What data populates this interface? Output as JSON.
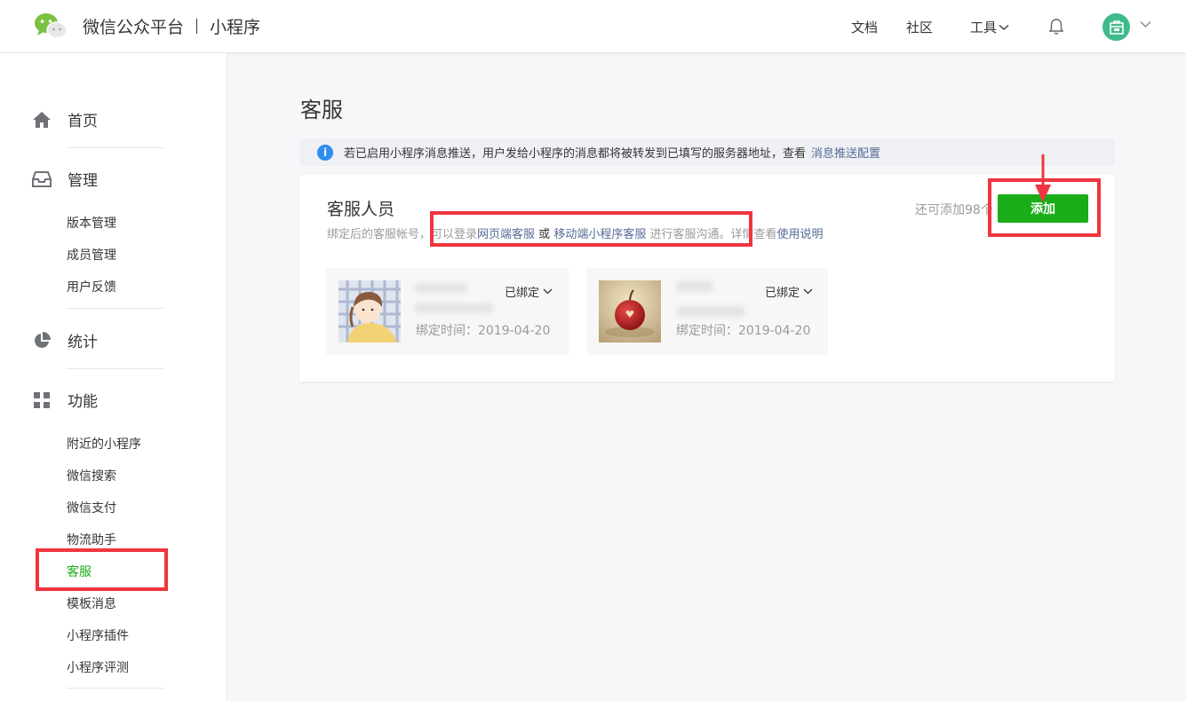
{
  "header": {
    "brand": "微信公众平台",
    "product": "小程序",
    "nav": {
      "docs": "文档",
      "community": "社区",
      "tools": "工具"
    },
    "icons": {
      "logo": "wechat-logo",
      "bell": "bell-icon",
      "avatar": "avatar",
      "chevron": "chevron-down-icon"
    }
  },
  "sidebar": {
    "home": "首页",
    "manage": {
      "label": "管理",
      "items": [
        "版本管理",
        "成员管理",
        "用户反馈"
      ]
    },
    "stats": "统计",
    "features": {
      "label": "功能",
      "items": [
        "附近的小程序",
        "微信搜索",
        "微信支付",
        "物流助手",
        "客服",
        "模板消息",
        "小程序插件",
        "小程序评测"
      ]
    },
    "active_item": "客服"
  },
  "main": {
    "title": "客服",
    "notice": {
      "text": "若已启用小程序消息推送，用户发给小程序的消息都将被转发到已填写的服务器地址，查看",
      "link": "消息推送配置"
    },
    "card": {
      "title": "客服人员",
      "desc_prefix": "绑定后的客服帐号，可以登录",
      "web_link": "网页端客服",
      "or": "或",
      "mobile_link": "移动端小程序客服",
      "desc_middle": "进行客服沟通。详情查看",
      "help_link": "使用说明",
      "remaining": "还可添加98个",
      "add_button": "添加"
    },
    "agents": [
      {
        "status": "已绑定",
        "bind_time": "绑定时间：2019-04-20"
      },
      {
        "status": "已绑定",
        "bind_time": "绑定时间：2019-04-20"
      }
    ]
  },
  "colors": {
    "brand_green": "#1aad19",
    "link_blue": "#576b95",
    "annotation_red": "#f0353f",
    "info_blue": "#2f8df0"
  }
}
